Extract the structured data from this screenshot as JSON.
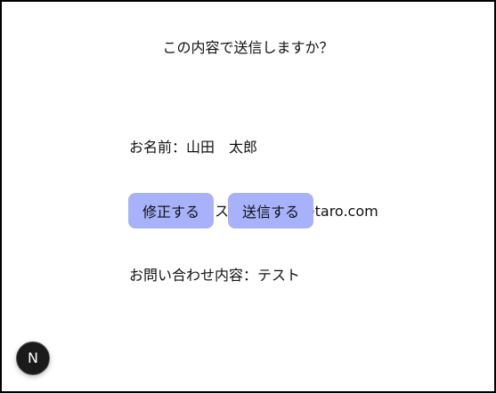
{
  "confirm": {
    "title": "この内容で送信しますか？"
  },
  "details": {
    "rows": [
      "お名前：山田　太郎",
      "メールアドレス：yamada@taro.com",
      "お問い合わせ内容：テスト"
    ]
  },
  "actions": {
    "edit_label": "修正する",
    "send_label": "送信する"
  },
  "dev_indicator": {
    "letter": "N",
    "icon": "nextjs-logo-icon"
  },
  "colors": {
    "button_bg": "#a8b2fb",
    "badge_bg": "#1a1a1a"
  }
}
